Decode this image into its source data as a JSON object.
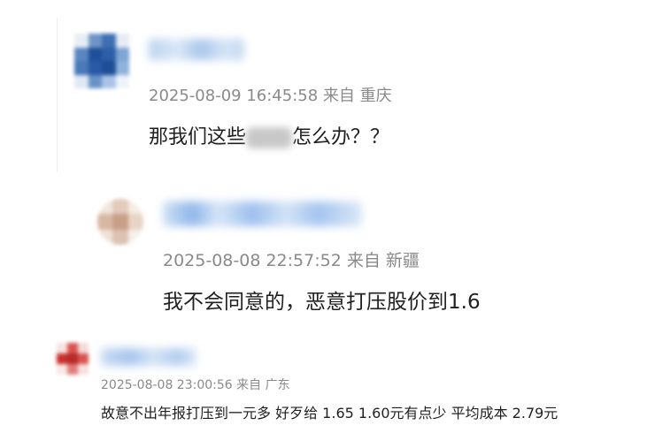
{
  "comments": [
    {
      "timestamp": "2025-08-09 16:45:58",
      "location_label": "来自 重庆",
      "text_before": "那我们这些",
      "text_after": "怎么办？？"
    },
    {
      "timestamp": "2025-08-08 22:57:52",
      "location_label": "来自 新疆",
      "text": "我不会同意的，恶意打压股价到1.6"
    },
    {
      "timestamp": "2025-08-08 23:00:56",
      "location_label": "来自 广东",
      "text": "故意不出年报打压到一元多 好歹给 1.65 1.60元有点少 平均成本 2.79元"
    }
  ]
}
